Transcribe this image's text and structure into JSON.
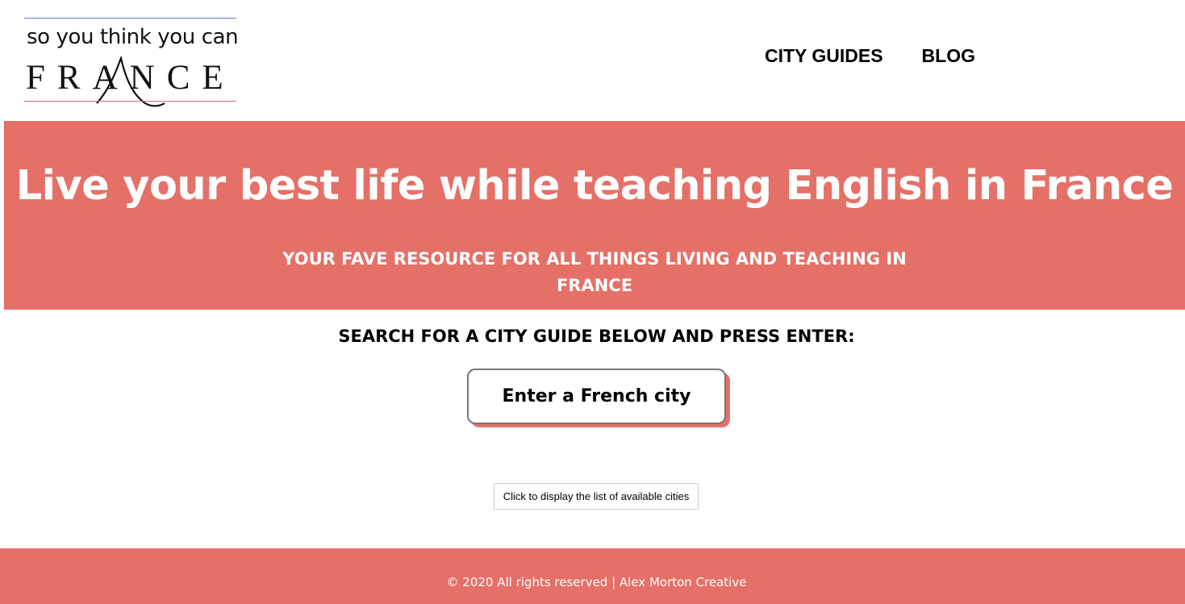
{
  "logo": {
    "top_text": "so you think you can",
    "main_text": "FRANCE"
  },
  "nav": {
    "items": [
      {
        "label": "CITY GUIDES"
      },
      {
        "label": "BLOG"
      }
    ]
  },
  "hero": {
    "title": "Live your best life while teaching English in France",
    "subtitle": "YOUR FAVE RESOURCE FOR ALL THINGS LIVING AND TEACHING IN FRANCE"
  },
  "search": {
    "label": "SEARCH FOR A CITY GUIDE BELOW AND PRESS ENTER:",
    "placeholder": "Enter a French city",
    "value": ""
  },
  "cities_button": {
    "label": "Click to display the list of available cities"
  },
  "footer": {
    "text": "© 2020 All rights reserved | Alex Morton Creative"
  },
  "colors": {
    "accent": "#e57068",
    "logo_line_top": "#6f7ae0",
    "logo_line_bottom": "#e06a77"
  }
}
